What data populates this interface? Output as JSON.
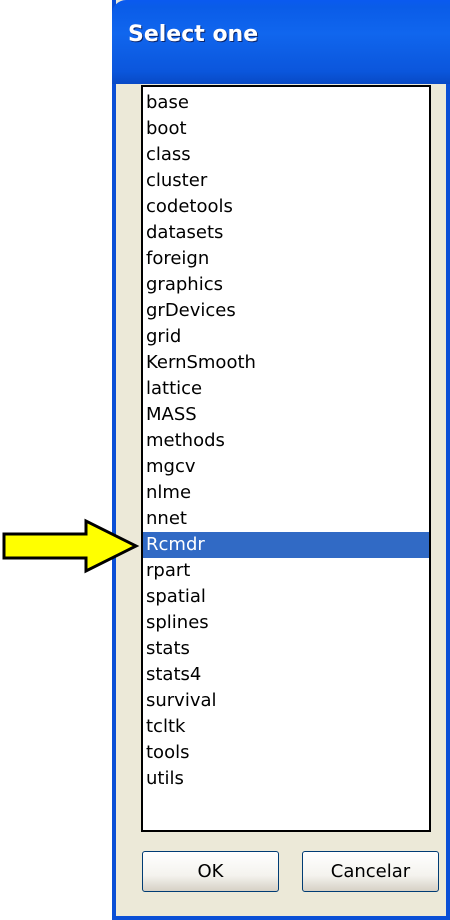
{
  "window": {
    "title": "Select one"
  },
  "list": {
    "items": [
      "base",
      "boot",
      "class",
      "cluster",
      "codetools",
      "datasets",
      "foreign",
      "graphics",
      "grDevices",
      "grid",
      "KernSmooth",
      "lattice",
      "MASS",
      "methods",
      "mgcv",
      "nlme",
      "nnet",
      "Rcmdr",
      "rpart",
      "spatial",
      "splines",
      "stats",
      "stats4",
      "survival",
      "tcltk",
      "tools",
      "utils"
    ],
    "selected": "Rcmdr"
  },
  "buttons": {
    "ok_label": "OK",
    "cancel_label": "Cancelar"
  },
  "colors": {
    "titlebar": "#0b56dc",
    "selection": "#316ac5",
    "arrow_fill": "#ffff00",
    "dialog_bg": "#ece9d8"
  },
  "annotation": {
    "icon": "pointer-arrow-icon"
  }
}
